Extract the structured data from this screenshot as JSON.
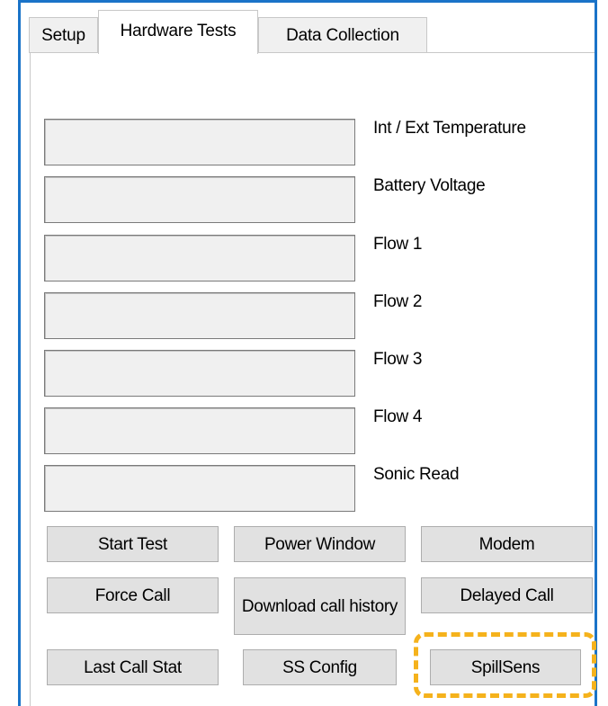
{
  "tabs": [
    {
      "label": "Setup",
      "active": false
    },
    {
      "label": "Hardware Tests",
      "active": true
    },
    {
      "label": "Data Collection",
      "active": false
    }
  ],
  "readouts": [
    {
      "label": "Int / Ext Temperature",
      "value": ""
    },
    {
      "label": "Battery Voltage",
      "value": ""
    },
    {
      "label": "Flow 1",
      "value": ""
    },
    {
      "label": "Flow 2",
      "value": ""
    },
    {
      "label": "Flow 3",
      "value": ""
    },
    {
      "label": "Flow 4",
      "value": ""
    },
    {
      "label": "Sonic Read",
      "value": ""
    }
  ],
  "buttons": {
    "start_test": "Start Test",
    "power_window": "Power Window",
    "modem": "Modem",
    "force_call": "Force Call",
    "download_call_history": "Download call history",
    "delayed_call": "Delayed Call",
    "last_call_stat": "Last Call Stat",
    "ss_config": "SS Config",
    "spillsens": "SpillSens"
  },
  "colors": {
    "window_border": "#1a73c8",
    "highlight": "#f5b21c",
    "button_face": "#e1e1e1",
    "field_face": "#f0f0f0"
  }
}
